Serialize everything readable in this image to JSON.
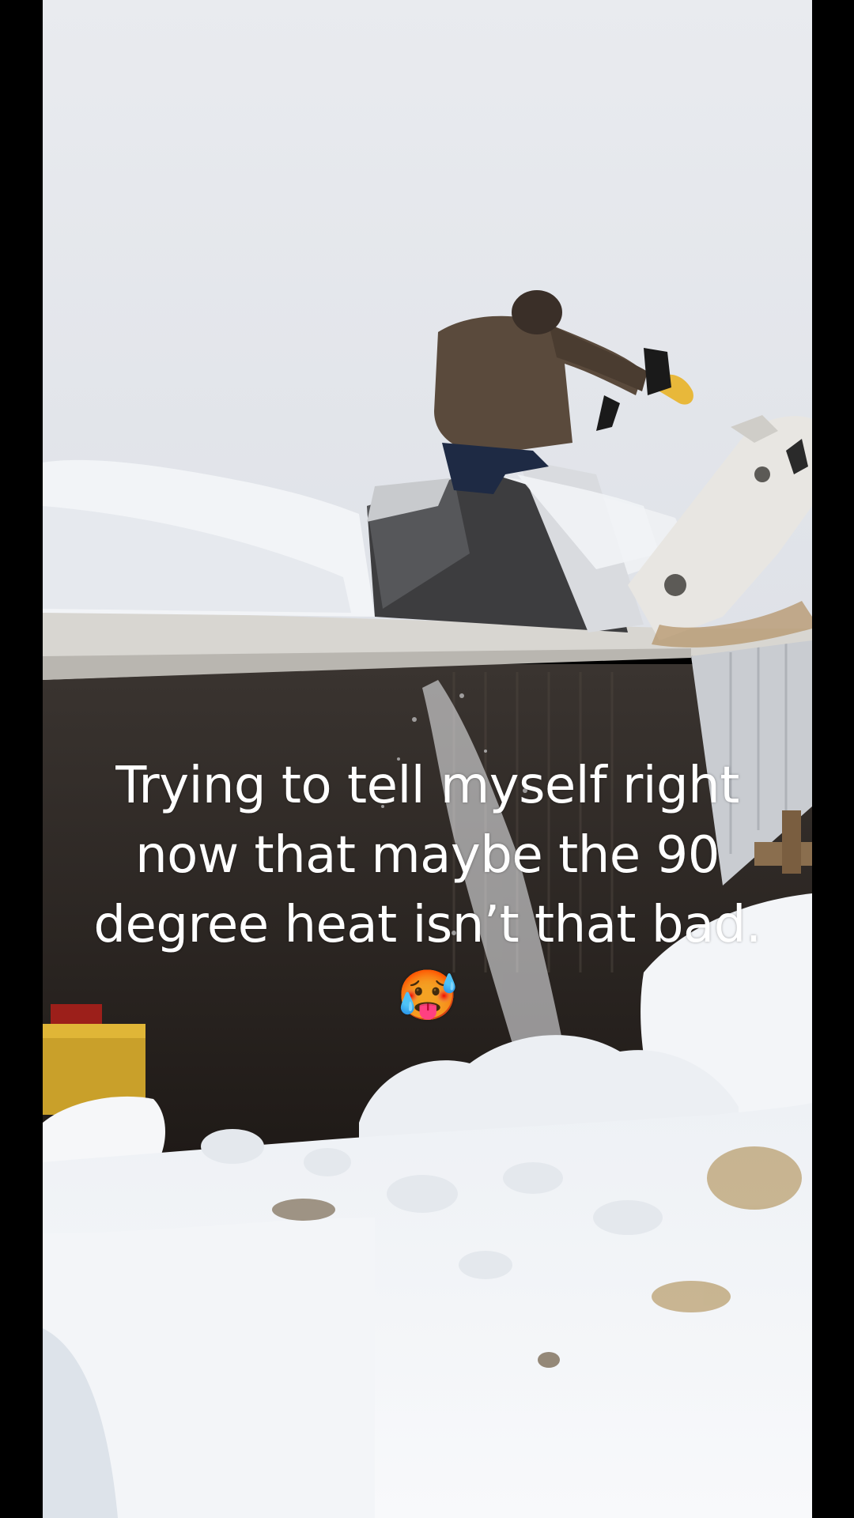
{
  "caption": {
    "lines": [
      "Trying to tell myself right",
      "now that maybe the 90",
      "degree heat isn’t that bad."
    ],
    "emoji": "🥵"
  },
  "scene": {
    "sky_color": "#e4e6eb",
    "snow_color": "#f4f6f9",
    "barn_interior_color": "#2a2420",
    "jacket_color": "#5a4a3c",
    "glove_color": "#e8b83a",
    "loader_color": "#e8e6e2"
  }
}
